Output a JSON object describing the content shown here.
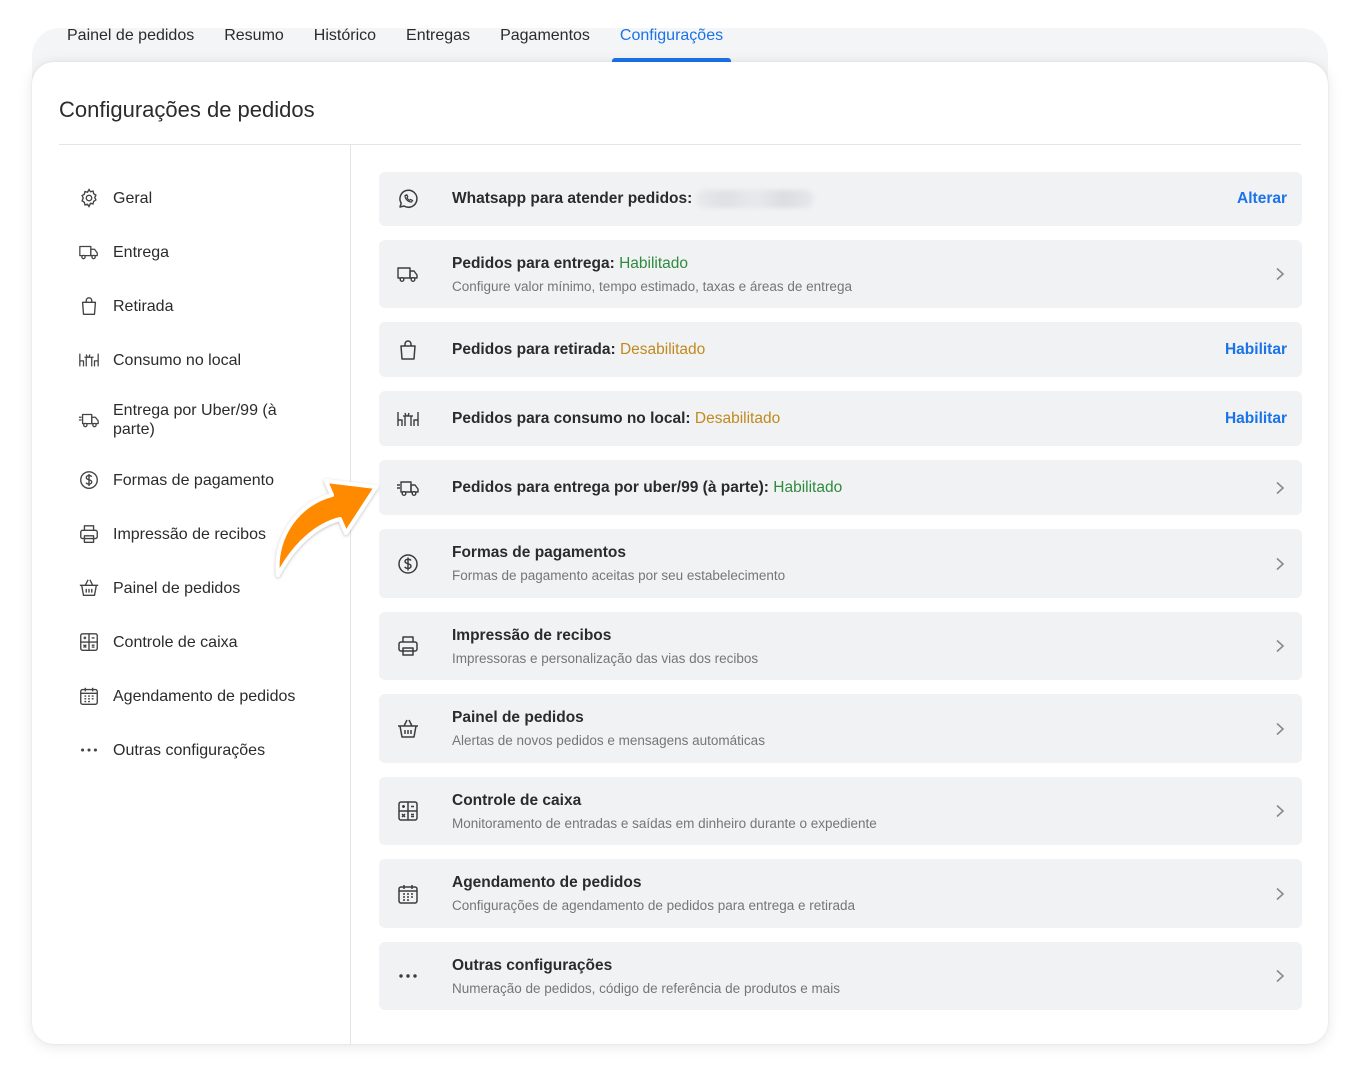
{
  "tabs": [
    {
      "label": "Painel de pedidos"
    },
    {
      "label": "Resumo"
    },
    {
      "label": "Histórico"
    },
    {
      "label": "Entregas"
    },
    {
      "label": "Pagamentos"
    },
    {
      "label": "Configurações",
      "active": true
    }
  ],
  "page": {
    "title": "Configurações de pedidos"
  },
  "sidebar": {
    "items": [
      {
        "label": "Geral",
        "icon": "gear-icon"
      },
      {
        "label": "Entrega",
        "icon": "delivery-truck-icon"
      },
      {
        "label": "Retirada",
        "icon": "shopping-bag-icon"
      },
      {
        "label": "Consumo no local",
        "icon": "dining-table-icon"
      },
      {
        "label": "Entrega por Uber/99 (à parte)",
        "icon": "fast-delivery-truck-icon"
      },
      {
        "label": "Formas de pagamento",
        "icon": "dollar-circle-icon"
      },
      {
        "label": "Impressão de recibos",
        "icon": "printer-icon"
      },
      {
        "label": "Painel de pedidos",
        "icon": "basket-icon"
      },
      {
        "label": "Controle de caixa",
        "icon": "calculator-icon"
      },
      {
        "label": "Agendamento de pedidos",
        "icon": "calendar-icon"
      },
      {
        "label": "Outras configurações",
        "icon": "more-dots-icon"
      }
    ]
  },
  "rows": {
    "whatsapp": {
      "title": "Whatsapp para atender pedidos:",
      "action": "Alterar",
      "icon": "whatsapp-icon"
    },
    "entrega": {
      "title": "Pedidos para entrega:",
      "status": "Habilitado",
      "subtitle": "Configure valor mínimo, tempo estimado, taxas e áreas de entrega",
      "icon": "delivery-truck-icon"
    },
    "retirada": {
      "title": "Pedidos para retirada:",
      "status": "Desabilitado",
      "action": "Habilitar",
      "icon": "shopping-bag-icon"
    },
    "consumo": {
      "title": "Pedidos para consumo no local:",
      "status": "Desabilitado",
      "action": "Habilitar",
      "icon": "dining-table-icon"
    },
    "uber": {
      "title": "Pedidos para entrega por uber/99 (à parte):",
      "status": "Habilitado",
      "icon": "fast-delivery-truck-icon"
    },
    "pagamentos": {
      "title": "Formas de pagamentos",
      "subtitle": "Formas de pagamento aceitas por seu estabelecimento",
      "icon": "dollar-circle-icon"
    },
    "recibos": {
      "title": "Impressão de recibos",
      "subtitle": "Impressoras e personalização das vias dos recibos",
      "icon": "printer-icon"
    },
    "painel": {
      "title": "Painel de pedidos",
      "subtitle": "Alertas de novos pedidos e mensagens automáticas",
      "icon": "basket-icon"
    },
    "caixa": {
      "title": "Controle de caixa",
      "subtitle": "Monitoramento de entradas e saídas em dinheiro durante o expediente",
      "icon": "calculator-icon"
    },
    "agendamento": {
      "title": "Agendamento de pedidos",
      "subtitle": "Configurações de agendamento de pedidos para entrega e retirada",
      "icon": "calendar-icon"
    },
    "outras": {
      "title": "Outras configurações",
      "subtitle": "Numeração de pedidos, código de referência de produtos e mais",
      "icon": "more-dots-icon"
    }
  },
  "colors": {
    "accent": "#1a73e8",
    "enabled": "#2e8b3e",
    "disabled": "#c08a1e",
    "annotation_arrow": "#ff8a00"
  }
}
